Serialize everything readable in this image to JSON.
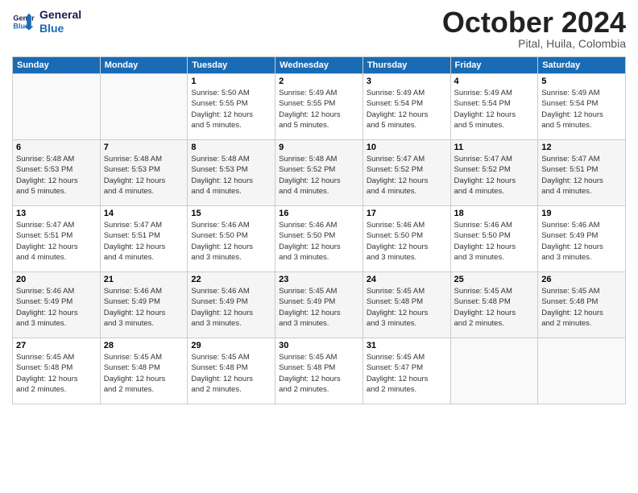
{
  "logo": {
    "line1": "General",
    "line2": "Blue"
  },
  "title": "October 2024",
  "subtitle": "Pital, Huila, Colombia",
  "weekdays": [
    "Sunday",
    "Monday",
    "Tuesday",
    "Wednesday",
    "Thursday",
    "Friday",
    "Saturday"
  ],
  "weeks": [
    [
      {
        "day": "",
        "info": ""
      },
      {
        "day": "",
        "info": ""
      },
      {
        "day": "1",
        "info": "Sunrise: 5:50 AM\nSunset: 5:55 PM\nDaylight: 12 hours\nand 5 minutes."
      },
      {
        "day": "2",
        "info": "Sunrise: 5:49 AM\nSunset: 5:55 PM\nDaylight: 12 hours\nand 5 minutes."
      },
      {
        "day": "3",
        "info": "Sunrise: 5:49 AM\nSunset: 5:54 PM\nDaylight: 12 hours\nand 5 minutes."
      },
      {
        "day": "4",
        "info": "Sunrise: 5:49 AM\nSunset: 5:54 PM\nDaylight: 12 hours\nand 5 minutes."
      },
      {
        "day": "5",
        "info": "Sunrise: 5:49 AM\nSunset: 5:54 PM\nDaylight: 12 hours\nand 5 minutes."
      }
    ],
    [
      {
        "day": "6",
        "info": "Sunrise: 5:48 AM\nSunset: 5:53 PM\nDaylight: 12 hours\nand 5 minutes."
      },
      {
        "day": "7",
        "info": "Sunrise: 5:48 AM\nSunset: 5:53 PM\nDaylight: 12 hours\nand 4 minutes."
      },
      {
        "day": "8",
        "info": "Sunrise: 5:48 AM\nSunset: 5:53 PM\nDaylight: 12 hours\nand 4 minutes."
      },
      {
        "day": "9",
        "info": "Sunrise: 5:48 AM\nSunset: 5:52 PM\nDaylight: 12 hours\nand 4 minutes."
      },
      {
        "day": "10",
        "info": "Sunrise: 5:47 AM\nSunset: 5:52 PM\nDaylight: 12 hours\nand 4 minutes."
      },
      {
        "day": "11",
        "info": "Sunrise: 5:47 AM\nSunset: 5:52 PM\nDaylight: 12 hours\nand 4 minutes."
      },
      {
        "day": "12",
        "info": "Sunrise: 5:47 AM\nSunset: 5:51 PM\nDaylight: 12 hours\nand 4 minutes."
      }
    ],
    [
      {
        "day": "13",
        "info": "Sunrise: 5:47 AM\nSunset: 5:51 PM\nDaylight: 12 hours\nand 4 minutes."
      },
      {
        "day": "14",
        "info": "Sunrise: 5:47 AM\nSunset: 5:51 PM\nDaylight: 12 hours\nand 4 minutes."
      },
      {
        "day": "15",
        "info": "Sunrise: 5:46 AM\nSunset: 5:50 PM\nDaylight: 12 hours\nand 3 minutes."
      },
      {
        "day": "16",
        "info": "Sunrise: 5:46 AM\nSunset: 5:50 PM\nDaylight: 12 hours\nand 3 minutes."
      },
      {
        "day": "17",
        "info": "Sunrise: 5:46 AM\nSunset: 5:50 PM\nDaylight: 12 hours\nand 3 minutes."
      },
      {
        "day": "18",
        "info": "Sunrise: 5:46 AM\nSunset: 5:50 PM\nDaylight: 12 hours\nand 3 minutes."
      },
      {
        "day": "19",
        "info": "Sunrise: 5:46 AM\nSunset: 5:49 PM\nDaylight: 12 hours\nand 3 minutes."
      }
    ],
    [
      {
        "day": "20",
        "info": "Sunrise: 5:46 AM\nSunset: 5:49 PM\nDaylight: 12 hours\nand 3 minutes."
      },
      {
        "day": "21",
        "info": "Sunrise: 5:46 AM\nSunset: 5:49 PM\nDaylight: 12 hours\nand 3 minutes."
      },
      {
        "day": "22",
        "info": "Sunrise: 5:46 AM\nSunset: 5:49 PM\nDaylight: 12 hours\nand 3 minutes."
      },
      {
        "day": "23",
        "info": "Sunrise: 5:45 AM\nSunset: 5:49 PM\nDaylight: 12 hours\nand 3 minutes."
      },
      {
        "day": "24",
        "info": "Sunrise: 5:45 AM\nSunset: 5:48 PM\nDaylight: 12 hours\nand 3 minutes."
      },
      {
        "day": "25",
        "info": "Sunrise: 5:45 AM\nSunset: 5:48 PM\nDaylight: 12 hours\nand 2 minutes."
      },
      {
        "day": "26",
        "info": "Sunrise: 5:45 AM\nSunset: 5:48 PM\nDaylight: 12 hours\nand 2 minutes."
      }
    ],
    [
      {
        "day": "27",
        "info": "Sunrise: 5:45 AM\nSunset: 5:48 PM\nDaylight: 12 hours\nand 2 minutes."
      },
      {
        "day": "28",
        "info": "Sunrise: 5:45 AM\nSunset: 5:48 PM\nDaylight: 12 hours\nand 2 minutes."
      },
      {
        "day": "29",
        "info": "Sunrise: 5:45 AM\nSunset: 5:48 PM\nDaylight: 12 hours\nand 2 minutes."
      },
      {
        "day": "30",
        "info": "Sunrise: 5:45 AM\nSunset: 5:48 PM\nDaylight: 12 hours\nand 2 minutes."
      },
      {
        "day": "31",
        "info": "Sunrise: 5:45 AM\nSunset: 5:47 PM\nDaylight: 12 hours\nand 2 minutes."
      },
      {
        "day": "",
        "info": ""
      },
      {
        "day": "",
        "info": ""
      }
    ]
  ]
}
